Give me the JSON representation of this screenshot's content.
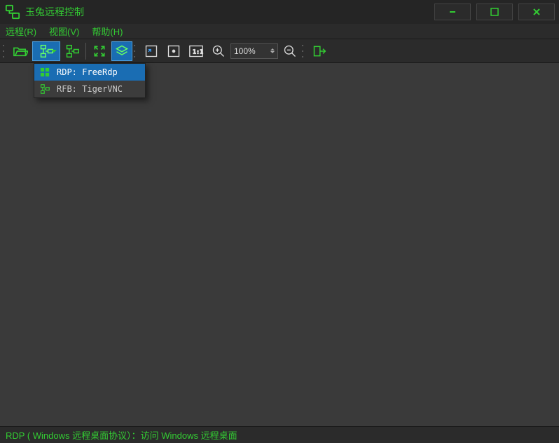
{
  "app": {
    "title": "玉兔远程控制"
  },
  "menu": {
    "remote": "远程(R)",
    "view": "视图(V)",
    "help": "帮助(H)"
  },
  "toolbar": {
    "zoom_value": "100%"
  },
  "dropdown": {
    "items": [
      {
        "label": "RDP: FreeRdp",
        "icon": "windows",
        "selected": true
      },
      {
        "label": "RFB: TigerVNC",
        "icon": "network",
        "selected": false
      }
    ]
  },
  "status": {
    "text": "RDP ( Windows 远程桌面协议）：访问 Windows 远程桌面"
  },
  "colors": {
    "accent": "#33cc33",
    "selection": "#1a6db3"
  }
}
